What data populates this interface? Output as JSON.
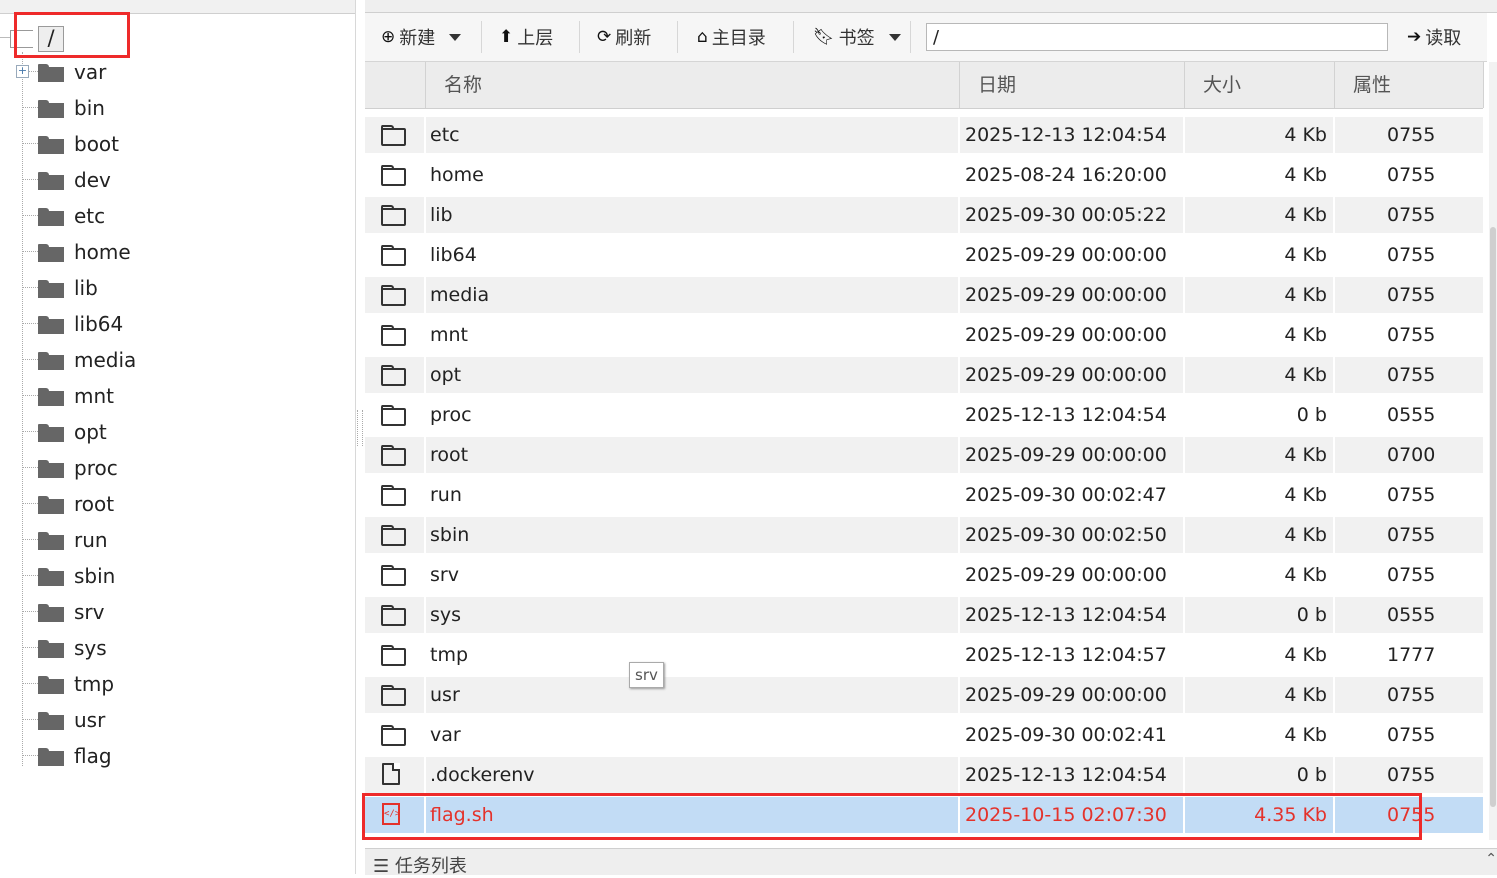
{
  "tree": {
    "root_label": "/",
    "items": [
      {
        "label": "var",
        "expandable": true
      },
      {
        "label": "bin"
      },
      {
        "label": "boot"
      },
      {
        "label": "dev"
      },
      {
        "label": "etc"
      },
      {
        "label": "home"
      },
      {
        "label": "lib"
      },
      {
        "label": "lib64"
      },
      {
        "label": "media"
      },
      {
        "label": "mnt"
      },
      {
        "label": "opt"
      },
      {
        "label": "proc"
      },
      {
        "label": "root"
      },
      {
        "label": "run"
      },
      {
        "label": "sbin"
      },
      {
        "label": "srv"
      },
      {
        "label": "sys"
      },
      {
        "label": "tmp"
      },
      {
        "label": "usr"
      },
      {
        "label": "flag"
      }
    ]
  },
  "toolbar": {
    "new_label": "新建",
    "up_label": "上层",
    "refresh_label": "刷新",
    "home_label": "主目录",
    "bookmark_label": "书签",
    "path_value": "/",
    "read_label": "读取"
  },
  "grid": {
    "headers": {
      "name": "名称",
      "date": "日期",
      "size": "大小",
      "perm": "属性"
    },
    "rows": [
      {
        "type": "folder",
        "name": "etc",
        "date": "2025-12-13 12:04:54",
        "size": "4 Kb",
        "perm": "0755"
      },
      {
        "type": "folder",
        "name": "home",
        "date": "2025-08-24 16:20:00",
        "size": "4 Kb",
        "perm": "0755"
      },
      {
        "type": "folder",
        "name": "lib",
        "date": "2025-09-30 00:05:22",
        "size": "4 Kb",
        "perm": "0755"
      },
      {
        "type": "folder",
        "name": "lib64",
        "date": "2025-09-29 00:00:00",
        "size": "4 Kb",
        "perm": "0755"
      },
      {
        "type": "folder",
        "name": "media",
        "date": "2025-09-29 00:00:00",
        "size": "4 Kb",
        "perm": "0755"
      },
      {
        "type": "folder",
        "name": "mnt",
        "date": "2025-09-29 00:00:00",
        "size": "4 Kb",
        "perm": "0755"
      },
      {
        "type": "folder",
        "name": "opt",
        "date": "2025-09-29 00:00:00",
        "size": "4 Kb",
        "perm": "0755"
      },
      {
        "type": "folder",
        "name": "proc",
        "date": "2025-12-13 12:04:54",
        "size": "0 b",
        "perm": "0555"
      },
      {
        "type": "folder",
        "name": "root",
        "date": "2025-09-29 00:00:00",
        "size": "4 Kb",
        "perm": "0700"
      },
      {
        "type": "folder",
        "name": "run",
        "date": "2025-09-30 00:02:47",
        "size": "4 Kb",
        "perm": "0755"
      },
      {
        "type": "folder",
        "name": "sbin",
        "date": "2025-09-30 00:02:50",
        "size": "4 Kb",
        "perm": "0755"
      },
      {
        "type": "folder",
        "name": "srv",
        "date": "2025-09-29 00:00:00",
        "size": "4 Kb",
        "perm": "0755"
      },
      {
        "type": "folder",
        "name": "sys",
        "date": "2025-12-13 12:04:54",
        "size": "0 b",
        "perm": "0555"
      },
      {
        "type": "folder",
        "name": "tmp",
        "date": "2025-12-13 12:04:57",
        "size": "4 Kb",
        "perm": "1777"
      },
      {
        "type": "folder",
        "name": "usr",
        "date": "2025-09-29 00:00:00",
        "size": "4 Kb",
        "perm": "0755"
      },
      {
        "type": "folder",
        "name": "var",
        "date": "2025-09-30 00:02:41",
        "size": "4 Kb",
        "perm": "0755"
      },
      {
        "type": "file",
        "name": ".dockerenv",
        "date": "2025-12-13 12:04:54",
        "size": "0 b",
        "perm": "0755"
      },
      {
        "type": "code",
        "name": "flag.sh",
        "date": "2025-10-15 02:07:30",
        "size": "4.35 Kb",
        "perm": "0755",
        "selected": true
      }
    ],
    "tooltip": "srv"
  },
  "taskbar": {
    "label": "任务列表"
  },
  "colors": {
    "highlight_red": "#ee2a2a",
    "selected_bg": "#c2dcf5",
    "selected_text": "#e4322b"
  }
}
